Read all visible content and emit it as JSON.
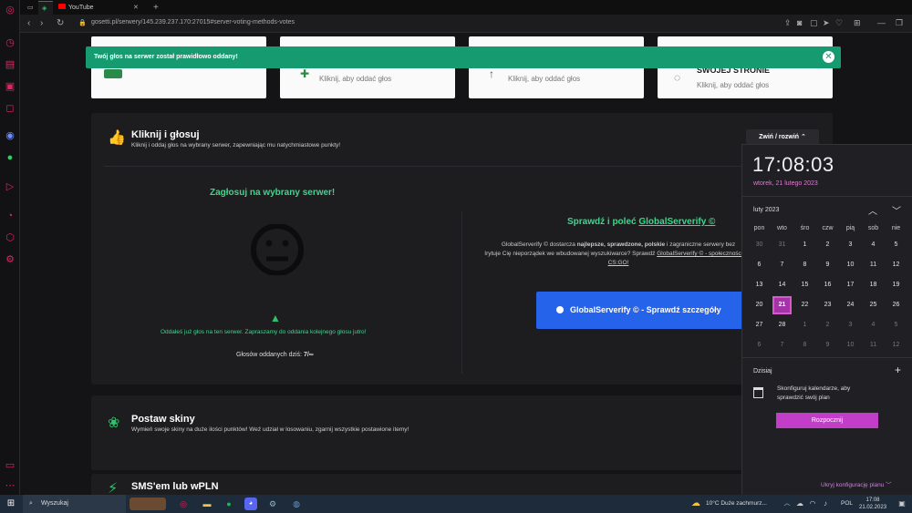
{
  "browser": {
    "tab_title": "YouTube",
    "url": "gosetti.pl/serwery/145.239.237.170:27015#server-voting-methods-votes"
  },
  "top_cards": [
    {
      "subtitle": ""
    },
    {
      "subtitle": "Kliknij, aby oddać głos"
    },
    {
      "subtitle": "Kliknij, aby oddać głos"
    },
    {
      "title": "SWOJEJ STRONIE",
      "subtitle": "Kliknij, aby oddać głos"
    }
  ],
  "toast": {
    "message": "Twój głos na serwer został prawidłowo oddany!"
  },
  "panel_click": {
    "title": "Kliknij i głosuj",
    "subtitle": "Kliknij i oddaj głos na wybrany serwer, zapewniając mu natychmiastowe punkty!",
    "toggle_label": "Zwiń / rozwiń",
    "vote_heading": "Zagłosuj na wybrany serwer!",
    "already_voted": "Oddałeś już głos na ten serwer. Zapraszamy do oddania kolejnego głosu jutro!",
    "votes_label": "Głosów oddanych dziś:",
    "votes_value": "7/∞",
    "gs_heading_prefix": "Sprawdź i poleć",
    "gs_heading_link": "GlobalServerify ©",
    "gs_text_1": "GlobalServerify © dostarcza",
    "gs_text_bold": "najlepsze, sprawdzone, polskie",
    "gs_text_2": "i zagraniczne serwery bez",
    "gs_text_3": "Irytuje Cię nieporządek we wbudowanej wyszukiwarce? Sprawdź",
    "gs_text_link": "GlobalServerify © - społeczności dla CS:GO!",
    "gs_button": "GlobalServerify © - Sprawdź szczegóły"
  },
  "panel_skins": {
    "title": "Postaw skiny",
    "subtitle": "Wymień swoje skiny na duże ilości punktów! Weź udział w losowaniu, zgarnij wszystkie postawione itemy!"
  },
  "panel_sms": {
    "title": "SMS'em lub wPLN"
  },
  "calendar": {
    "time": "17:08:03",
    "date": "wtorek, 21 lutego 2023",
    "month": "luty 2023",
    "weekdays": [
      "pon",
      "wto",
      "śro",
      "czw",
      "pią",
      "sob",
      "nie"
    ],
    "weeks": [
      [
        "30",
        "31",
        "1",
        "2",
        "3",
        "4",
        "5"
      ],
      [
        "6",
        "7",
        "8",
        "9",
        "10",
        "11",
        "12"
      ],
      [
        "13",
        "14",
        "15",
        "16",
        "17",
        "18",
        "19"
      ],
      [
        "20",
        "21",
        "22",
        "23",
        "24",
        "25",
        "26"
      ],
      [
        "27",
        "28",
        "1",
        "2",
        "3",
        "4",
        "5"
      ],
      [
        "6",
        "7",
        "8",
        "9",
        "10",
        "11",
        "12"
      ]
    ],
    "selected": "21",
    "today_label": "Dzisiaj",
    "config_text": "Skonfiguruj kalendarze, aby sprawdzić swój plan",
    "start_button": "Rozpocznij",
    "hide_plan": "Ukryj konfigurację planu"
  },
  "taskbar": {
    "search": "Wyszukaj",
    "weather": "10°C  Duże zachmurz...",
    "lang": "POL",
    "clock_time": "17:08",
    "clock_date": "21.02.2023"
  }
}
